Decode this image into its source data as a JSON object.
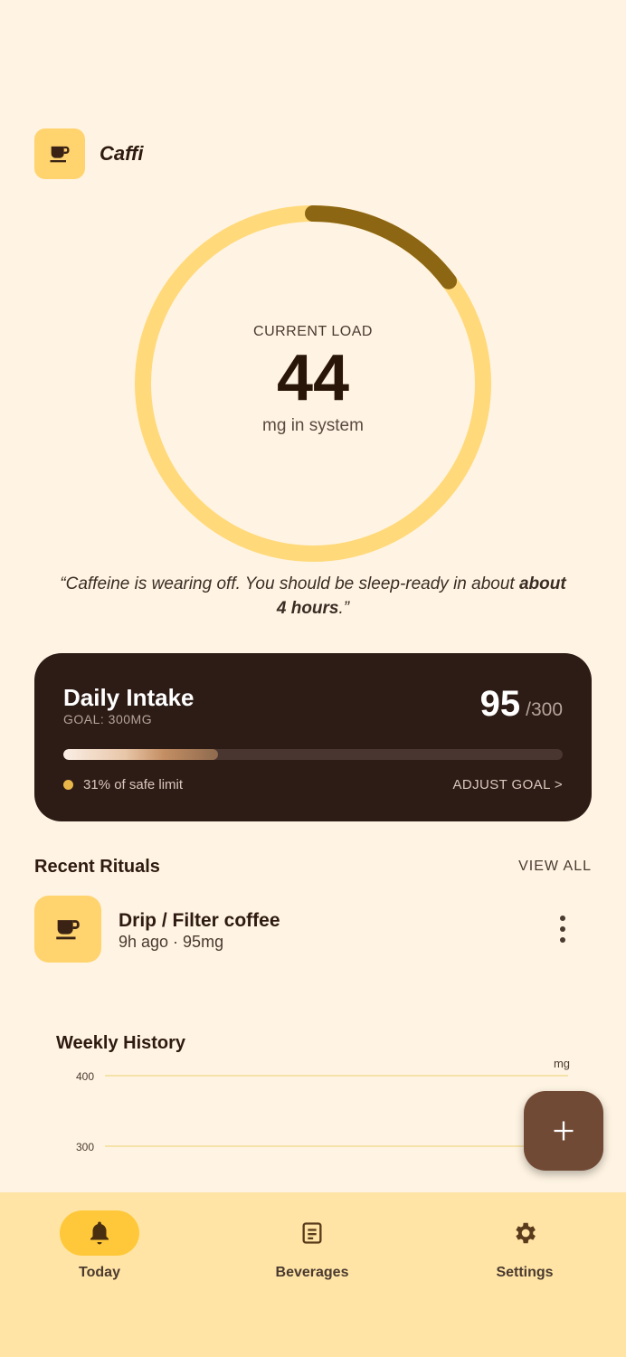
{
  "app": {
    "title": "Caffi"
  },
  "load": {
    "label": "CURRENT LOAD",
    "value": "44",
    "unit": "mg in system",
    "progress_fraction": 0.147
  },
  "quote": {
    "prefix": "“Caffeine is wearing off. You should be sleep-ready in about ",
    "bold": "about 4 hours",
    "suffix": ".”"
  },
  "intake": {
    "title": "Daily Intake",
    "goal": "GOAL: 300MG",
    "current": "95",
    "max": "/300",
    "progress_fraction": 0.31,
    "limit_text": "31% of safe limit",
    "adjust_label": "ADJUST GOAL >"
  },
  "recent": {
    "title": "Recent Rituals",
    "view_all": "VIEW ALL",
    "items": [
      {
        "name": "Drip / Filter coffee",
        "meta": "9h ago · 95mg"
      }
    ]
  },
  "chart_data": {
    "type": "bar",
    "title": "Weekly History",
    "ylabel": "mg",
    "y_ticks": [
      "400",
      "300"
    ],
    "ylim": [
      0,
      400
    ],
    "grid": true
  },
  "nav": {
    "items": [
      {
        "label": "Today",
        "icon": "bell-icon",
        "active": true
      },
      {
        "label": "Beverages",
        "icon": "receipt-icon",
        "active": false
      },
      {
        "label": "Settings",
        "icon": "gear-icon",
        "active": false
      }
    ]
  },
  "colors": {
    "background": "#fff4e3",
    "accent": "#ffd36e",
    "ring_progress": "#8c6612",
    "card": "#2d1b15",
    "fab": "#714a36",
    "nav": "#ffe4a5"
  }
}
